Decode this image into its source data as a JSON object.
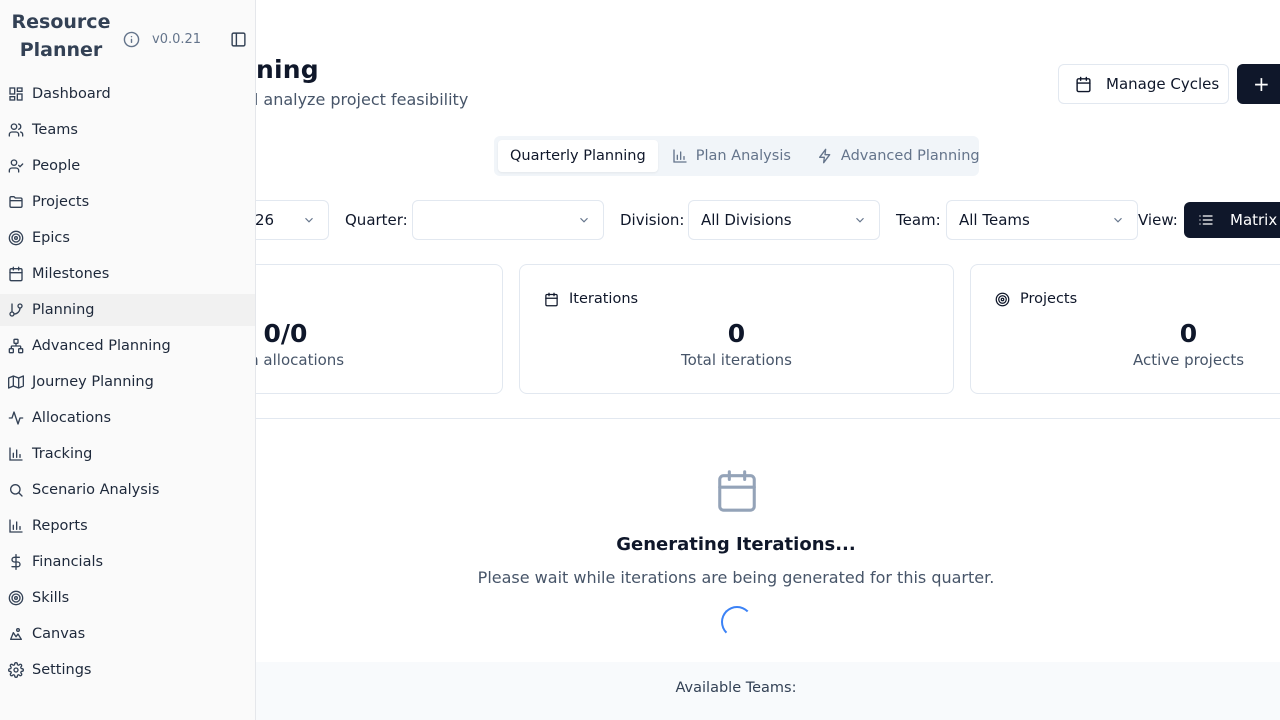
{
  "app": {
    "brand_line1": "Resource",
    "brand_line2": "Planner",
    "version": "v0.0.21"
  },
  "sidebar": {
    "items": [
      {
        "label": "Dashboard",
        "icon": "dashboard-icon"
      },
      {
        "label": "Teams",
        "icon": "users-icon"
      },
      {
        "label": "People",
        "icon": "user-check-icon"
      },
      {
        "label": "Projects",
        "icon": "folder-icon"
      },
      {
        "label": "Epics",
        "icon": "target-icon"
      },
      {
        "label": "Milestones",
        "icon": "calendar-icon"
      },
      {
        "label": "Planning",
        "icon": "git-branch-icon",
        "active": true
      },
      {
        "label": "Advanced Planning",
        "icon": "network-icon"
      },
      {
        "label": "Journey Planning",
        "icon": "map-icon"
      },
      {
        "label": "Allocations",
        "icon": "activity-icon"
      },
      {
        "label": "Tracking",
        "icon": "bar-chart-icon"
      },
      {
        "label": "Scenario Analysis",
        "icon": "search-icon"
      },
      {
        "label": "Reports",
        "icon": "bar-chart-icon"
      },
      {
        "label": "Financials",
        "icon": "dollar-icon"
      },
      {
        "label": "Skills",
        "icon": "target-icon"
      },
      {
        "label": "Canvas",
        "icon": "canvas-icon"
      },
      {
        "label": "Settings",
        "icon": "gear-icon"
      }
    ]
  },
  "header": {
    "title": "nning",
    "subtitle": "nd analyze project feasibility",
    "manage_cycles_label": "Manage Cycles",
    "add_label": "+"
  },
  "tabs": [
    {
      "label": "Quarterly Planning",
      "active": true
    },
    {
      "label": "Plan Analysis",
      "icon": "bar-chart-icon"
    },
    {
      "label": "Advanced Planning",
      "icon": "zap-icon"
    }
  ],
  "filters": {
    "year_value": "26",
    "quarter_label": "Quarter:",
    "quarter_value": "",
    "division_label": "Division:",
    "division_value": "All Divisions",
    "team_label": "Team:",
    "team_value": "All Teams",
    "view_label": "View:",
    "view_value": "Matrix"
  },
  "cards": [
    {
      "title": "",
      "value": "0/0",
      "sub": "with allocations"
    },
    {
      "title": "Iterations",
      "value": "0",
      "sub": "Total iterations",
      "icon": "calendar-icon"
    },
    {
      "title": "Projects",
      "value": "0",
      "sub": "Active projects",
      "icon": "target-icon"
    }
  ],
  "status": {
    "title": "Generating Iterations...",
    "message": "Please wait while iterations are being generated for this quarter."
  },
  "footer": {
    "available_teams_label": "Available Teams:"
  }
}
